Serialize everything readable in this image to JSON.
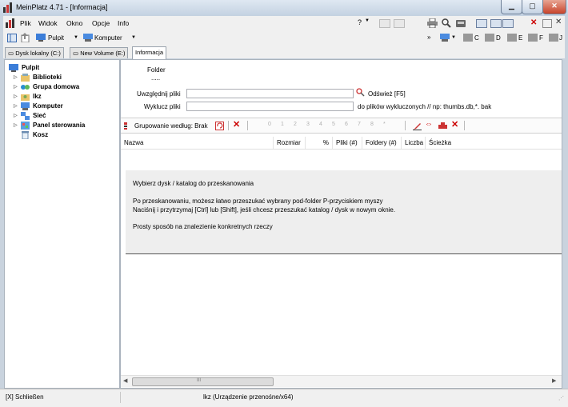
{
  "window": {
    "title": "MeinPlatz 4.71 - [Informacja]"
  },
  "menu": {
    "items": [
      "Plik",
      "Widok",
      "Okno",
      "Opcje",
      "Info"
    ],
    "help_icon": "?"
  },
  "toolbar": {
    "desktop_label": "Pulpit",
    "computer_label": "Komputer",
    "drives": [
      "C",
      "D",
      "E",
      "F",
      "J"
    ]
  },
  "tabs": [
    {
      "label": "Dysk lokalny (C:)"
    },
    {
      "label": "New Volume (E:)"
    },
    {
      "label": "Informacja"
    }
  ],
  "tree": {
    "root": "Pulpit",
    "items": [
      {
        "label": "Biblioteki",
        "icon": "library-icon"
      },
      {
        "label": "Grupa domowa",
        "icon": "homegroup-icon"
      },
      {
        "label": "lkz",
        "icon": "user-folder-icon"
      },
      {
        "label": "Komputer",
        "icon": "computer-icon"
      },
      {
        "label": "Sieć",
        "icon": "network-icon"
      },
      {
        "label": "Panel sterowania",
        "icon": "control-panel-icon"
      },
      {
        "label": "Kosz",
        "icon": "recycle-bin-icon"
      }
    ]
  },
  "info": {
    "folder_label": "Folder",
    "folder_value": ".....",
    "include_label": "Uwzględnij pliki",
    "include_value": "",
    "exclude_label": "Wyklucz pliki",
    "exclude_value": "",
    "refresh_label": "Odśwież [F5]",
    "exclude_hint": "do plików wykluczonych // np: thumbs.db,*. bak"
  },
  "grouping": {
    "label": "Grupowanie według: Brak",
    "level_buttons": [
      "0",
      "1",
      "2",
      "3",
      "4",
      "5",
      "6",
      "7",
      "8",
      "*"
    ]
  },
  "columns": [
    "Nazwa",
    "Rozmiar",
    "%",
    "Pliki (#)",
    "Foldery (#)",
    "Liczba",
    "Ścieżka"
  ],
  "message": {
    "line1": "Wybierz dysk / katalog do przeskanowania",
    "line2": "Po przeskanowaniu, możesz łatwo przeszukać wybrany pod-folder P-przyciskiem myszy",
    "line3": "Naciśnij i przytrzymaj [Ctrl] lub [Shift], jeśli chcesz przeszukać katalog / dysk w nowym oknie.",
    "line4": "Prosty sposób na znalezienie konkretnych rzeczy"
  },
  "scrollbar": {
    "grip": "III"
  },
  "status": {
    "left": "[X] Schließen",
    "center": "lkz (Urządzenie przenośne/x64)"
  }
}
